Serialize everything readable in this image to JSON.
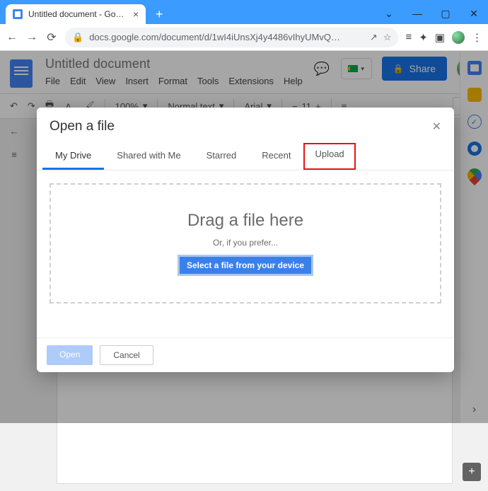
{
  "browser": {
    "tab_title": "Untitled document - Google Docs",
    "url": "docs.google.com/document/d/1wI4iUnsXj4y4486vIhyUMvQ…",
    "new_tab_glyph": "+",
    "close_glyph": "×",
    "min_glyph": "—",
    "max_glyph": "▢",
    "win_close_glyph": "✕",
    "caret_glyph": "⌄"
  },
  "nav": {
    "back": "←",
    "forward": "→",
    "reload": "⟳",
    "lock": "🔒",
    "share_glyph": "↗",
    "star": "☆",
    "readlist": "≡",
    "ext": "✦",
    "puzzle": "▣",
    "menu": "⋮"
  },
  "docs": {
    "title": "Untitled document",
    "menu": [
      "File",
      "Edit",
      "View",
      "Insert",
      "Format",
      "Tools",
      "Extensions",
      "Help"
    ],
    "share_label": "Share",
    "lock_glyph": "🔒",
    "comment_glyph": "💬"
  },
  "toolbar": {
    "undo": "↶",
    "redo": "↷",
    "print": "🖶",
    "spell": "Ａ",
    "paint": "🖌",
    "zoom": "100%",
    "style": "Normal text",
    "font": "Arial",
    "size": "11",
    "align": "≡",
    "pencil": "✎"
  },
  "outline": {
    "back": "←",
    "list": "≡"
  },
  "modal": {
    "title": "Open a file",
    "close": "✕",
    "tabs": [
      "My Drive",
      "Shared with Me",
      "Starred",
      "Recent",
      "Upload"
    ],
    "dz_headline": "Drag a file here",
    "dz_sub": "Or, if you prefer...",
    "dz_button": "Select a file from your device",
    "open": "Open",
    "cancel": "Cancel"
  },
  "rail": {
    "chevron": "›"
  },
  "addwidget": "+"
}
